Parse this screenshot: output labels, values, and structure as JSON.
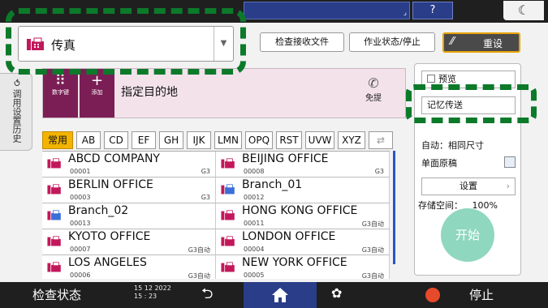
{
  "header": {
    "help_label": "?",
    "moon_glyph": "☾",
    "status_right_glyph": "⌟"
  },
  "mode_selector": {
    "label": "传真",
    "dropdown_glyph": "▼",
    "icon": "fax-icon"
  },
  "actions": {
    "check_received": "检查接收文件",
    "job_status": "作业状态/停止",
    "reset": "重设",
    "reset_icon_glyph": "⁄⁄"
  },
  "history_tab": {
    "label": "调用设置历史",
    "icon_glyph": "⟲"
  },
  "destination": {
    "tiles": [
      {
        "glyph": "⠿",
        "label": "数字键"
      },
      {
        "glyph": "+",
        "label": "添加"
      }
    ],
    "label": "指定目的地",
    "handsfree_label": "免提",
    "handsfree_glyph": "✆"
  },
  "index_tabs": [
    "常用",
    "AB",
    "CD",
    "EF",
    "GH",
    "IJK",
    "LMN",
    "OPQ",
    "RST",
    "UVW",
    "XYZ",
    "⇄"
  ],
  "address_list": [
    {
      "name": "ABCD COMPANY",
      "number": "00001",
      "type": "G3"
    },
    {
      "name": "BEIJING OFFICE",
      "number": "00008",
      "type": "G3"
    },
    {
      "name": "BERLIN OFFICE",
      "number": "00003",
      "type": "G3"
    },
    {
      "name": "Branch_01",
      "number": "00012",
      "type": ""
    },
    {
      "name": "Branch_02",
      "number": "00013",
      "type": ""
    },
    {
      "name": "HONG KONG OFFICE",
      "number": "00011",
      "type": "G3自动"
    },
    {
      "name": "KYOTO OFFICE",
      "number": "00007",
      "type": "G3自动"
    },
    {
      "name": "LONDON OFFICE",
      "number": "00004",
      "type": "G3自动"
    },
    {
      "name": "LOS ANGELES",
      "number": "00006",
      "type": "G3自动"
    },
    {
      "name": "NEW YORK OFFICE",
      "number": "00005",
      "type": "G3自动"
    }
  ],
  "right_panel": {
    "preview_label": "预览",
    "memory_transmission": "记忆传送",
    "auto_same_size": "自动：相同尺寸",
    "single_sided": "单面原稿",
    "settings": "设置",
    "settings_chevron": "›",
    "storage_label": "存储空间：",
    "storage_value": "100%",
    "start_label": "开始"
  },
  "bottom_bar": {
    "check_status": "检查状态",
    "date": "15 12 2022",
    "time": "15 : 23",
    "back_glyph": "⮌",
    "gear_glyph": "✿",
    "stop_label": "停止"
  },
  "colors": {
    "top_bar": "#1f1f1f",
    "accent_blue": "#2a3d88",
    "tile_magenta": "#7a1e55",
    "active_tab": "#f2b400",
    "start_button": "#8fd7be",
    "highlight_dash": "#0c7a2a",
    "stop_red": "#e74a2a"
  }
}
